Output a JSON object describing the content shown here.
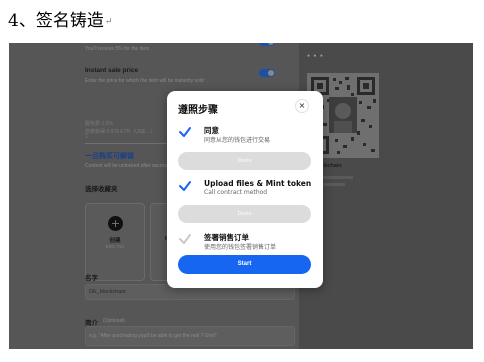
{
  "document": {
    "heading": "4、签名铸造",
    "paragraph_mark": "↵"
  },
  "form": {
    "royalty_hint": "You'll receive 5% for the item",
    "instant_price_label": "Instant sale price",
    "instant_price_hint": "Enter the price for which the item will be instantly sold",
    "price_value": "1",
    "fee_line": "服务费 2.5%",
    "receive_line": "您将获得 0.975 ETH（US$ ...）",
    "unlock_link": "一旦购买可解锁",
    "unlock_hint": "Content will be unlocked after successful transaction",
    "collection_label": "选择收藏夹",
    "card_create_title": "创建",
    "card_create_sub": "ERC-721",
    "card_second_title": "Ra",
    "name_label": "名字",
    "name_value": "DE_blockchain",
    "desc_label": "简介",
    "desc_optional": "(Optional)",
    "desc_placeholder": "e.g. \"After purchasing you'll be able to get the real T-Shirt\""
  },
  "preview": {
    "carousel_dots": "● ● ●",
    "chain_label": "blockchain"
  },
  "dialog": {
    "title": "遵照步骤",
    "close_label": "×",
    "steps": [
      {
        "title": "同意",
        "subtitle": "同意从您的钱包进行交易",
        "button": "Done",
        "status": "done"
      },
      {
        "title": "Upload files & Mint token",
        "subtitle": "Call contract method",
        "button": "Done",
        "status": "done"
      },
      {
        "title": "签署销售订单",
        "subtitle": "使用您的钱包签署销售订单",
        "status": "pending"
      }
    ],
    "start_label": "Start"
  },
  "colors": {
    "accent": "#1766f2",
    "check_done": "#1766f2",
    "check_pending": "#c9c9c9",
    "overlay_bg": "#474747",
    "dialog_bg": "#ffffff",
    "done_button": "#dcdcdc"
  },
  "icons": {
    "close": "close-icon",
    "check": "check-icon",
    "plus": "plus-icon",
    "qr": "qr-code-icon"
  }
}
